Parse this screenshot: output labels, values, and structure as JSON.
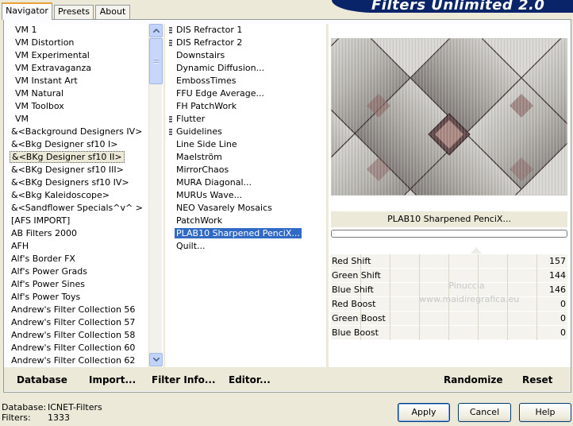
{
  "tabs": [
    {
      "label": "Navigator",
      "active": true
    },
    {
      "label": "Presets",
      "active": false
    },
    {
      "label": "About",
      "active": false
    }
  ],
  "banner_title": "Filters Unlimited 2.0",
  "categories": [
    "VM 1",
    "VM Distortion",
    "VM Experimental",
    "VM Extravaganza",
    "VM Instant Art",
    "VM Natural",
    "VM Toolbox",
    "VM",
    "&<Background Designers IV>",
    "&<Bkg Designer sf10 I>",
    "&<BKg Designer sf10 II>",
    "&<BKg Designer sf10 III>",
    "&<BKg Designers sf10 IV>",
    "&<Bkg Kaleidoscope>",
    "&<Sandflower Specials^v^ >",
    "[AFS IMPORT]",
    "AB Filters 2000",
    "AFH",
    "Alf's Border FX",
    "Alf's Power Grads",
    "Alf's Power Sines",
    "Alf's Power Toys",
    "Andrew's Filter Collection 56",
    "Andrew's Filter Collection 57",
    "Andrew's Filter Collection 58",
    "Andrew's Filter Collection 60",
    "Andrew's Filter Collection 62"
  ],
  "selected_category": "&<BKg Designer sf10 II>",
  "filters": [
    {
      "label": "DIS Refractor 1",
      "mark": true
    },
    {
      "label": "DIS Refractor 2",
      "mark": true
    },
    {
      "label": "Downstairs",
      "mark": false
    },
    {
      "label": "Dynamic Diffusion...",
      "mark": false
    },
    {
      "label": "EmbossTimes",
      "mark": false
    },
    {
      "label": "FFU Edge Average...",
      "mark": false
    },
    {
      "label": "FH PatchWork",
      "mark": false
    },
    {
      "label": "Flutter",
      "mark": true
    },
    {
      "label": "Guidelines",
      "mark": true
    },
    {
      "label": "Line Side Line",
      "mark": false
    },
    {
      "label": "Maelström",
      "mark": false
    },
    {
      "label": "MirrorChaos",
      "mark": false
    },
    {
      "label": "MURA Diagonal...",
      "mark": false
    },
    {
      "label": "MURUs Wave...",
      "mark": false
    },
    {
      "label": "NEO Vasarely Mosaics",
      "mark": false
    },
    {
      "label": "PatchWork",
      "mark": false
    },
    {
      "label": "PLAB10 Sharpened PenciX...",
      "mark": false
    },
    {
      "label": "Quilt...",
      "mark": false
    }
  ],
  "selected_filter": "PLAB10 Sharpened PenciX...",
  "effect_name": "PLAB10 Sharpened PenciX...",
  "params": [
    {
      "label": "Red Shift",
      "value": "157"
    },
    {
      "label": "Green Shift",
      "value": "144"
    },
    {
      "label": "Blue Shift",
      "value": "146"
    },
    {
      "label": "Red Boost",
      "value": "0"
    },
    {
      "label": "Green Boost",
      "value": "0"
    },
    {
      "label": "Blue Boost",
      "value": "0"
    }
  ],
  "watermark": {
    "line1": "Pinuccia",
    "line2": "www.maidiregrafica.eu"
  },
  "commands": {
    "database": "Database",
    "import": "Import...",
    "filter_info": "Filter Info...",
    "editor": "Editor...",
    "randomize": "Randomize",
    "reset": "Reset"
  },
  "info": {
    "database_label": "Database:",
    "database_value": "ICNET-Filters",
    "filters_label": "Filters:",
    "filters_value": "1333"
  },
  "buttons": {
    "apply": "Apply",
    "cancel": "Cancel",
    "help": "Help"
  },
  "colors": {
    "selection": "#316ac5",
    "banner": "#0a246a",
    "tab_highlight": "#e8a23a"
  }
}
